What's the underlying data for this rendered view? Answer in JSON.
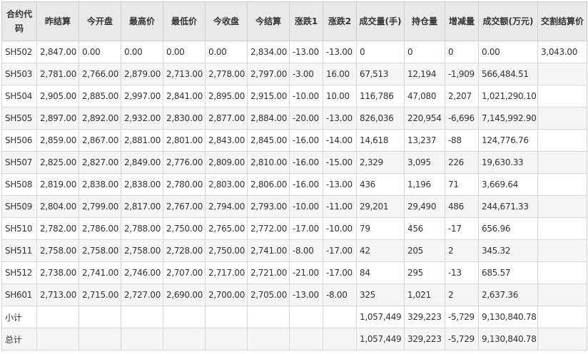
{
  "columns": [
    "合约代码",
    "昨结算",
    "今开盘",
    "最高价",
    "最低价",
    "今收盘",
    "今结算",
    "涨跌1",
    "涨跌2",
    "成交量(手)",
    "持仓量",
    "增减量",
    "成交额(万元)",
    "交割结算价"
  ],
  "rows": [
    [
      "SH502",
      "2,847.00",
      "0.00",
      "0.00",
      "0.00",
      "0.00",
      "2,834.00",
      "-13.00",
      "-13.00",
      "0",
      "0",
      "0",
      "0.00",
      "3,043.00"
    ],
    [
      "SH503",
      "2,781.00",
      "2,766.00",
      "2,879.00",
      "2,713.00",
      "2,778.00",
      "2,797.00",
      "-3.00",
      "16.00",
      "67,513",
      "12,194",
      "-1,909",
      "566,484.51",
      ""
    ],
    [
      "SH504",
      "2,905.00",
      "2,885.00",
      "2,997.00",
      "2,841.00",
      "2,895.00",
      "2,915.00",
      "-10.00",
      "10.00",
      "116,786",
      "47,080",
      "2,207",
      "1,021,290.10",
      ""
    ],
    [
      "SH505",
      "2,897.00",
      "2,892.00",
      "2,932.00",
      "2,830.00",
      "2,877.00",
      "2,884.00",
      "-20.00",
      "-13.00",
      "826,036",
      "220,954",
      "-6,696",
      "7,145,992.90",
      ""
    ],
    [
      "SH506",
      "2,859.00",
      "2,867.00",
      "2,881.00",
      "2,801.00",
      "2,843.00",
      "2,845.00",
      "-16.00",
      "-14.00",
      "14,618",
      "13,237",
      "-88",
      "124,776.76",
      ""
    ],
    [
      "SH507",
      "2,825.00",
      "2,827.00",
      "2,849.00",
      "2,776.00",
      "2,809.00",
      "2,810.00",
      "-16.00",
      "-15.00",
      "2,329",
      "3,095",
      "226",
      "19,630.33",
      ""
    ],
    [
      "SH508",
      "2,819.00",
      "2,838.00",
      "2,838.00",
      "2,780.00",
      "2,803.00",
      "2,806.00",
      "-16.00",
      "-13.00",
      "436",
      "1,196",
      "71",
      "3,669.64",
      ""
    ],
    [
      "SH509",
      "2,804.00",
      "2,799.00",
      "2,817.00",
      "2,767.00",
      "2,794.00",
      "2,793.00",
      "-10.00",
      "-11.00",
      "29,201",
      "29,490",
      "486",
      "244,671.33",
      ""
    ],
    [
      "SH510",
      "2,782.00",
      "2,786.00",
      "2,788.00",
      "2,750.00",
      "2,765.00",
      "2,772.00",
      "-17.00",
      "-10.00",
      "79",
      "456",
      "-17",
      "656.96",
      ""
    ],
    [
      "SH511",
      "2,758.00",
      "2,758.00",
      "2,758.00",
      "2,728.00",
      "2,750.00",
      "2,741.00",
      "-8.00",
      "-17.00",
      "42",
      "205",
      "2",
      "345.32",
      ""
    ],
    [
      "SH512",
      "2,738.00",
      "2,741.00",
      "2,746.00",
      "2,707.00",
      "2,717.00",
      "2,721.00",
      "-21.00",
      "-17.00",
      "84",
      "295",
      "-13",
      "685.57",
      ""
    ],
    [
      "SH601",
      "2,713.00",
      "2,715.00",
      "2,727.00",
      "2,690.00",
      "2,700.00",
      "2,705.00",
      "-13.00",
      "-8.00",
      "325",
      "1,021",
      "2",
      "2,637.36",
      ""
    ],
    [
      "小计",
      "",
      "",
      "",
      "",
      "",
      "",
      "",
      "",
      "1,057,449",
      "329,223",
      "-5,729",
      "9,130,840.78",
      ""
    ],
    [
      "总计",
      "",
      "",
      "",
      "",
      "",
      "",
      "",
      "",
      "1,057,449",
      "329,223",
      "-5,729",
      "9,130,840.78",
      ""
    ]
  ]
}
